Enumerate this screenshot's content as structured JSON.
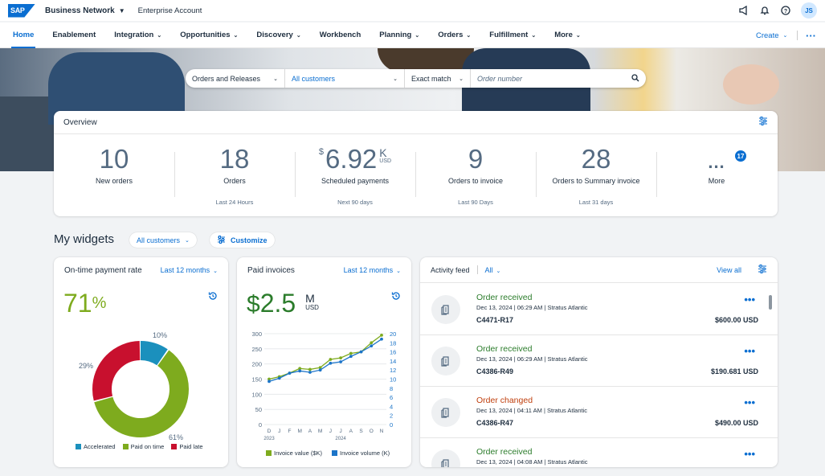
{
  "shell": {
    "logo_text": "SAP",
    "product": "Business Network",
    "account": "Enterprise Account",
    "user_initials": "JS"
  },
  "nav": {
    "items": [
      {
        "label": "Home"
      },
      {
        "label": "Enablement"
      },
      {
        "label": "Integration"
      },
      {
        "label": "Opportunities"
      },
      {
        "label": "Discovery"
      },
      {
        "label": "Workbench"
      },
      {
        "label": "Planning"
      },
      {
        "label": "Orders"
      },
      {
        "label": "Fulfillment"
      },
      {
        "label": "More"
      }
    ],
    "create_label": "Create"
  },
  "search": {
    "document_type": "Orders and Releases",
    "customer": "All customers",
    "match": "Exact match",
    "placeholder": "Order number"
  },
  "overview": {
    "title": "Overview",
    "kpis": [
      {
        "value": "10",
        "label": "New orders",
        "sub": ""
      },
      {
        "value": "18",
        "label": "Orders",
        "sub": "Last 24 Hours"
      },
      {
        "currency": "$",
        "value": "6.92",
        "unit": "K",
        "unit_currency": "USD",
        "label": "Scheduled payments",
        "sub": "Next 90 days"
      },
      {
        "value": "9",
        "label": "Orders to invoice",
        "sub": "Last 90 Days"
      },
      {
        "value": "28",
        "label": "Orders to Summary invoice",
        "sub": "Last 31 days"
      },
      {
        "value": "...",
        "label": "More",
        "badge": "17",
        "sub": ""
      }
    ]
  },
  "widgets": {
    "title": "My widgets",
    "customers_filter": "All customers",
    "customize_label": "Customize"
  },
  "payment_rate": {
    "title": "On-time payment rate",
    "period": "Last 12 months",
    "value": "71",
    "value_unit": "%",
    "colors": {
      "accelerated": "#1b90bd",
      "paid_on_time": "#7eab1e",
      "paid_late": "#c8102e"
    }
  },
  "paid_invoices": {
    "title": "Paid invoices",
    "period": "Last 12 months",
    "currency": "$",
    "value": "2.5",
    "unit": "M",
    "unit_currency": "USD"
  },
  "activity": {
    "title": "Activity feed",
    "filter": "All",
    "view_all": "View all",
    "items": [
      {
        "title": "Order received",
        "meta": "Dec 13, 2024  |  06:29 AM  |  Stratus Atlantic",
        "id": "C4471-R17",
        "amount": "$600.00 USD",
        "color": "#2b7c2b"
      },
      {
        "title": "Order received",
        "meta": "Dec 13, 2024  |  06:29 AM  |  Stratus Atlantic",
        "id": "C4386-R49",
        "amount": "$190.681 USD",
        "color": "#2b7c2b"
      },
      {
        "title": "Order changed",
        "meta": "Dec 13, 2024  |  04:11 AM  |  Stratus Atlantic",
        "id": "C4386-R47",
        "amount": "$490.00 USD",
        "color": "#c0400f"
      },
      {
        "title": "Order received",
        "meta": "Dec 13, 2024  |  04:08 AM  |  Stratus Atlantic",
        "id": "",
        "amount": "",
        "color": "#2b7c2b"
      }
    ]
  },
  "chart_data": [
    {
      "type": "pie",
      "title": "On-time payment rate",
      "categories": [
        "Accelerated",
        "Paid on time",
        "Paid late"
      ],
      "values": [
        10,
        61,
        29
      ],
      "value_labels": [
        "10%",
        "61%",
        "29%"
      ],
      "colors": [
        "#1b90bd",
        "#7eab1e",
        "#c8102e"
      ],
      "donut": true,
      "legend": "bottom"
    },
    {
      "type": "line",
      "title": "Paid invoices",
      "x": [
        "D",
        "J",
        "F",
        "M",
        "A",
        "M",
        "J",
        "J",
        "A",
        "S",
        "O",
        "N"
      ],
      "x_years": [
        "2023",
        "2024"
      ],
      "series": [
        {
          "name": "Invoice value ($K)",
          "axis": "left",
          "color": "#7eab1e",
          "values": [
            150,
            158,
            170,
            185,
            182,
            188,
            215,
            220,
            235,
            240,
            270,
            295
          ]
        },
        {
          "name": "Invoice volume (K)",
          "axis": "right",
          "color": "#1b74c8",
          "values": [
            9.5,
            10.2,
            11.3,
            11.8,
            11.5,
            12.0,
            13.5,
            13.8,
            15.0,
            16.0,
            17.3,
            18.8
          ]
        }
      ],
      "yticks_left": [
        "300",
        "250",
        "200",
        "150",
        "100",
        "50",
        "0"
      ],
      "yticks_right": [
        "20",
        "18",
        "16",
        "14",
        "12",
        "10",
        "8",
        "6",
        "4",
        "2",
        "0"
      ],
      "ylim_left": [
        0,
        300
      ],
      "ylim_right": [
        0,
        20
      ],
      "legend": "bottom",
      "grid": true
    }
  ]
}
